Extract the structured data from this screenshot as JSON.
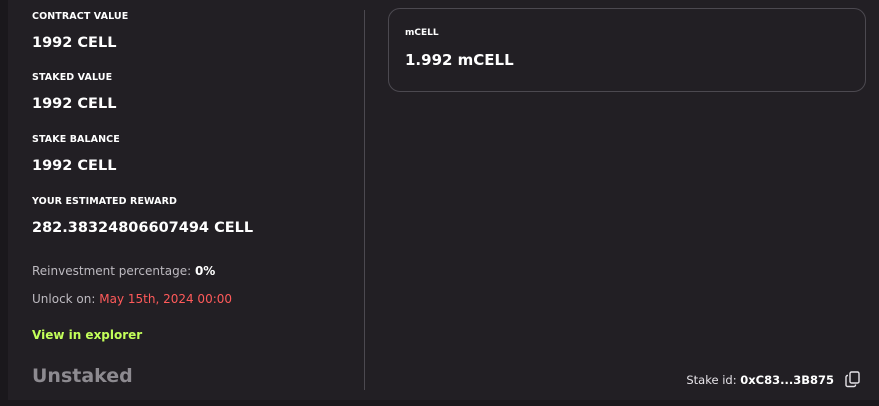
{
  "stats": [
    {
      "label": "CONTRACT VALUE",
      "value": "1992 CELL"
    },
    {
      "label": "STAKED VALUE",
      "value": "1992 CELL"
    },
    {
      "label": "STAKE BALANCE",
      "value": "1992 CELL"
    },
    {
      "label": "YOUR ESTIMATED REWARD",
      "value": "282.38324806607494 CELL"
    }
  ],
  "reinvest": {
    "label": "Reinvestment percentage:",
    "value": "0%"
  },
  "unlock": {
    "label": "Unlock on:",
    "value": "May 15th, 2024 00:00"
  },
  "explorer_link": "View in explorer",
  "status": "Unstaked",
  "mcell": {
    "label": "mCELL",
    "value": "1.992 mCELL"
  },
  "stake_id": {
    "label": "Stake id:",
    "value": "0xC83...3B875"
  },
  "colors": {
    "accent_green": "#c3ff5a",
    "danger_red": "#ff5a5a",
    "panel": "#221f24"
  },
  "icons": {
    "copy": "copy-icon"
  }
}
